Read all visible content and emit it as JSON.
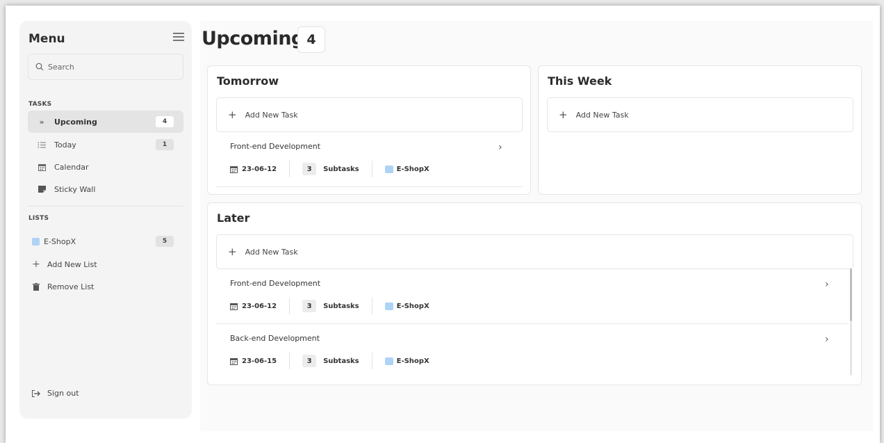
{
  "sidebar": {
    "title": "Menu",
    "search_placeholder": "Search",
    "tasks_label": "TASKS",
    "tasks": [
      {
        "label": "Upcoming",
        "count": "4",
        "icon": "double-chevron-right-icon"
      },
      {
        "label": "Today",
        "count": "1",
        "icon": "checklist-icon"
      },
      {
        "label": "Calendar",
        "icon": "calendar-icon"
      },
      {
        "label": "Sticky Wall",
        "icon": "sticky-note-icon"
      }
    ],
    "lists_label": "LISTS",
    "lists": [
      {
        "label": "E-ShopX",
        "count": "5",
        "color": "#aed3f5"
      }
    ],
    "add_list_label": "Add New List",
    "remove_list_label": "Remove List",
    "signout_label": "Sign out"
  },
  "header": {
    "title": "Upcoming",
    "count": "4"
  },
  "sections": {
    "tomorrow": {
      "title": "Tomorrow",
      "add_label": "Add New Task",
      "tasks": [
        {
          "name": "Front-end Development",
          "date": "23-06-12",
          "subtasks": "3",
          "subtasks_label": "Subtasks",
          "list": "E-ShopX"
        }
      ]
    },
    "this_week": {
      "title": "This Week",
      "add_label": "Add New Task"
    },
    "later": {
      "title": "Later",
      "add_label": "Add New Task",
      "tasks": [
        {
          "name": "Front-end Development",
          "date": "23-06-12",
          "subtasks": "3",
          "subtasks_label": "Subtasks",
          "list": "E-ShopX"
        },
        {
          "name": "Back-end Development",
          "date": "23-06-15",
          "subtasks": "3",
          "subtasks_label": "Subtasks",
          "list": "E-ShopX"
        }
      ]
    }
  },
  "colors": {
    "list_eshopx": "#aed3f5",
    "active_item_bg": "#e4e4e4"
  }
}
